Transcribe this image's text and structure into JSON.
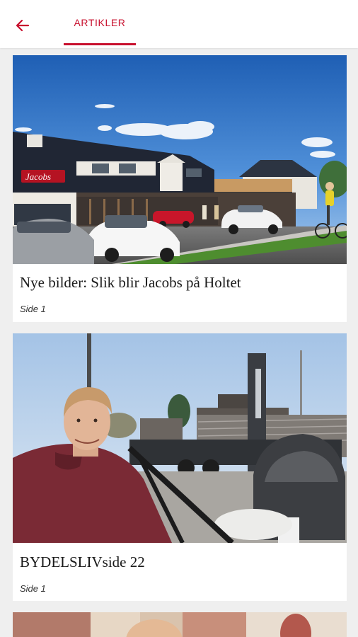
{
  "header": {
    "back_icon": "arrow-left-icon",
    "tab_label": "ARTIKLER",
    "accent_color": "#c8102e"
  },
  "articles": [
    {
      "title": "Nye bilder: Slik blir Jacobs på Holtet",
      "page": "Side 1",
      "image_sign_text": "Jacobs"
    },
    {
      "title": "BYDELSLIVside 22",
      "page": "Side 1"
    },
    {
      "title": "",
      "page": ""
    }
  ]
}
